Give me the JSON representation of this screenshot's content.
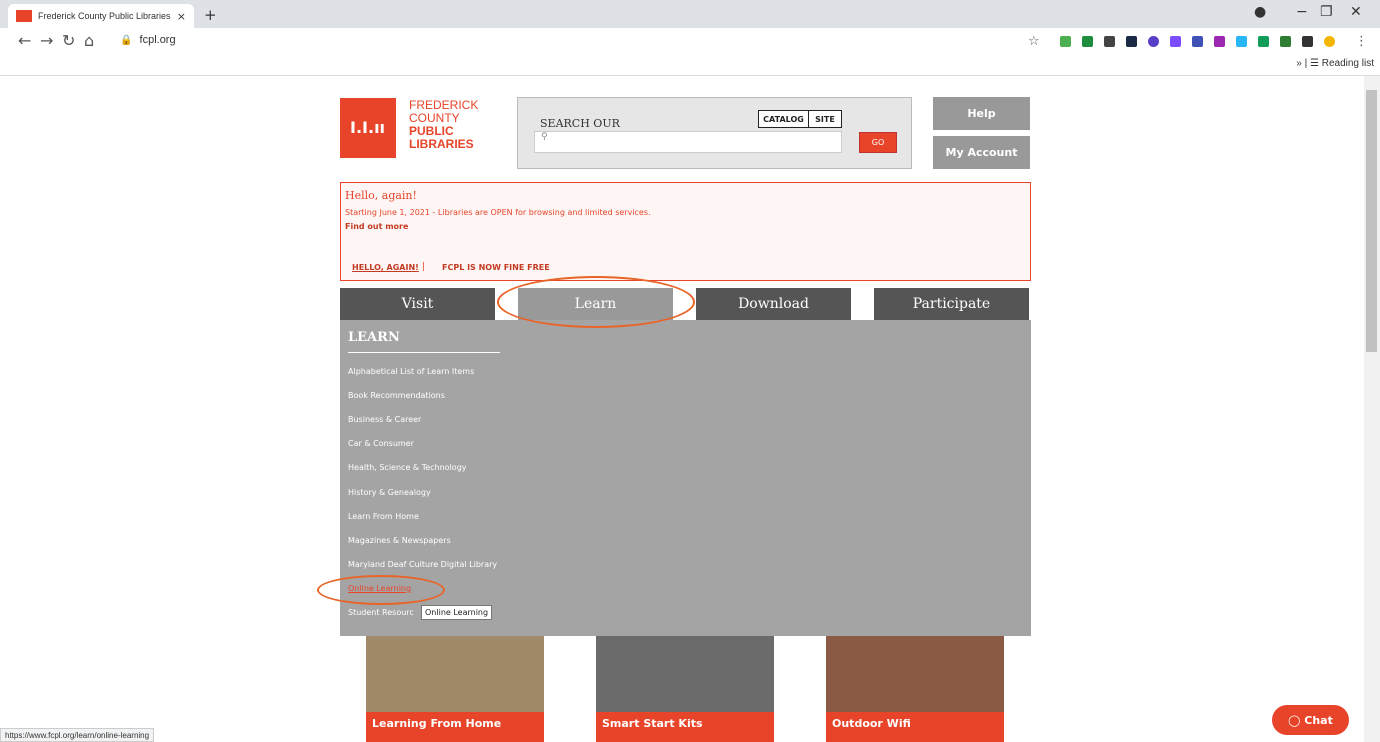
{
  "browser": {
    "tab_title": "Frederick County Public Libraries",
    "tab_close": "×",
    "new_tab": "+",
    "url": "fcpl.org",
    "reading_list": "Reading list",
    "status_url": "https://www.fcpl.org/learn/online-learning"
  },
  "logo": {
    "line1": "FREDERICK",
    "line2": "COUNTY",
    "line3": "PUBLIC",
    "line4": "LIBRARIES"
  },
  "search": {
    "label": "SEARCH OUR",
    "tab_catalog": "CATALOG",
    "tab_site": "SITE",
    "go": "GO"
  },
  "account": {
    "help": "Help",
    "my_account": "My Account"
  },
  "alert": {
    "title": "Hello, again!",
    "body": "Starting June 1, 2021 - Libraries are OPEN for browsing and limited services.",
    "link": "Find out more",
    "link1": "HELLO, AGAIN!",
    "separator": "|",
    "link2": "FCPL IS NOW FINE FREE"
  },
  "nav": {
    "visit": "Visit",
    "learn": "Learn",
    "download": "Download",
    "participate": "Participate"
  },
  "mega": {
    "heading": "LEARN",
    "items": [
      "Alphabetical List of Learn Items",
      "Book Recommendations",
      "Business & Career",
      "Car & Consumer",
      "Health, Science & Technology",
      "History & Genealogy",
      "Learn From Home",
      "Magazines & Newspapers",
      "Maryland Deaf Culture Digital Library",
      "Online Learning",
      "Student Resourc"
    ],
    "tooltip": "Online Learning"
  },
  "cards": [
    {
      "caption": "Learning From Home"
    },
    {
      "caption": "Smart Start Kits"
    },
    {
      "caption": "Outdoor Wifi"
    }
  ],
  "chat": "Chat",
  "colors": {
    "brand": "#e8442a",
    "nav_dark": "#555555",
    "nav_active": "#999999",
    "annotation": "#e8652a"
  }
}
